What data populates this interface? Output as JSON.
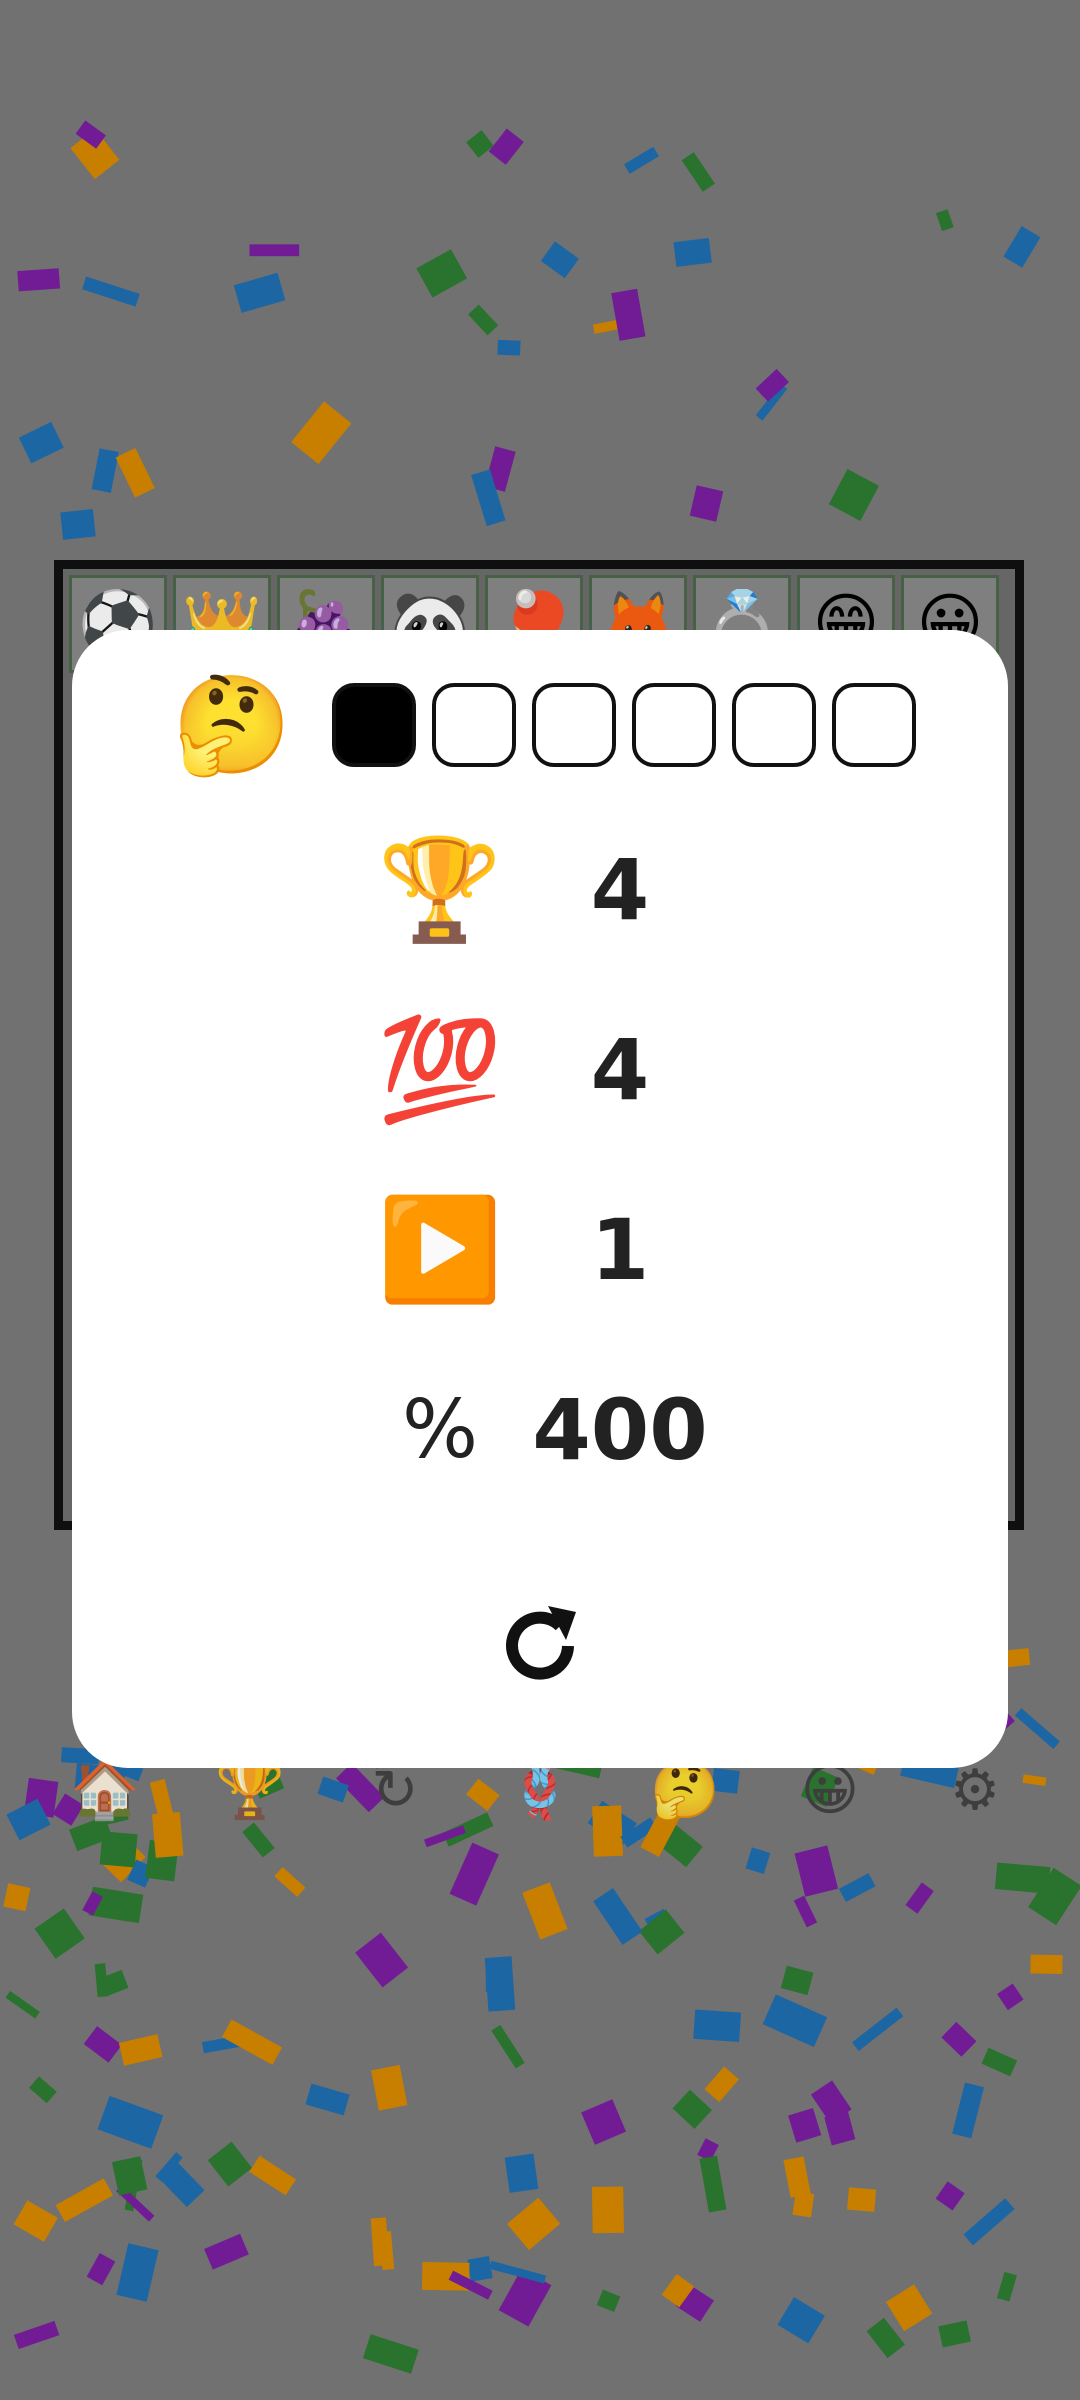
{
  "board": {
    "top_tiles": [
      "⚽",
      "👑",
      "🍇",
      "🐼",
      "🏓",
      "🦊",
      "💍",
      "😁",
      "😀"
    ]
  },
  "bottom_bar": {
    "items": [
      "🏠",
      "🏆",
      "↻",
      "🪢",
      "🤔",
      "😀",
      "⚙"
    ]
  },
  "modal": {
    "thinking_emoji": "🤔",
    "progress": {
      "filled": 1,
      "total": 6
    },
    "stats": [
      {
        "icon": "🏆",
        "value": "4",
        "name": "trophy"
      },
      {
        "icon": "💯",
        "value": "4",
        "name": "hundred"
      },
      {
        "icon": "▶️",
        "value": "1",
        "name": "play"
      },
      {
        "icon": "%",
        "value": "400",
        "name": "percent"
      }
    ],
    "refresh_icon": "refresh-icon"
  },
  "colors": {
    "confetti": [
      "#7b1fa2",
      "#1f6fb2",
      "#2e7d32",
      "#d98a00"
    ]
  }
}
